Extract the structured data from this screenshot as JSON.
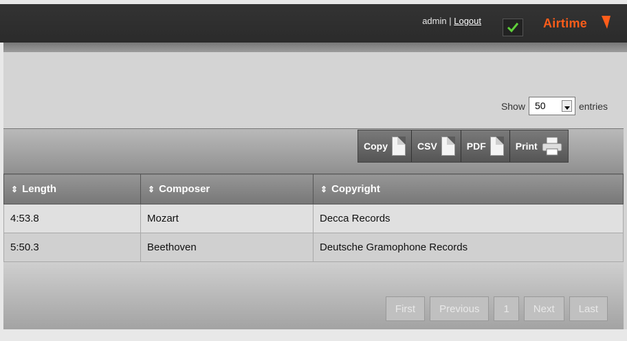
{
  "header": {
    "username": "admin",
    "logout_label": "Logout",
    "logo_text": "Airtime"
  },
  "length_select": {
    "prefix": "Show",
    "value": "50",
    "suffix": "entries"
  },
  "export_buttons": [
    "Copy",
    "CSV",
    "PDF",
    "Print"
  ],
  "table": {
    "columns": [
      "Length",
      "Composer",
      "Copyright"
    ],
    "rows": [
      [
        "4:53.8",
        "Mozart",
        "Decca Records"
      ],
      [
        "5:50.3",
        "Beethoven",
        "Deutsche Gramophone Records"
      ]
    ]
  },
  "pagination": [
    "First",
    "Previous",
    "1",
    "Next",
    "Last"
  ],
  "colors": {
    "topbar": "#2f2f2f",
    "brand_orange": "#ff5d1a",
    "check_green": "#4caf50"
  }
}
